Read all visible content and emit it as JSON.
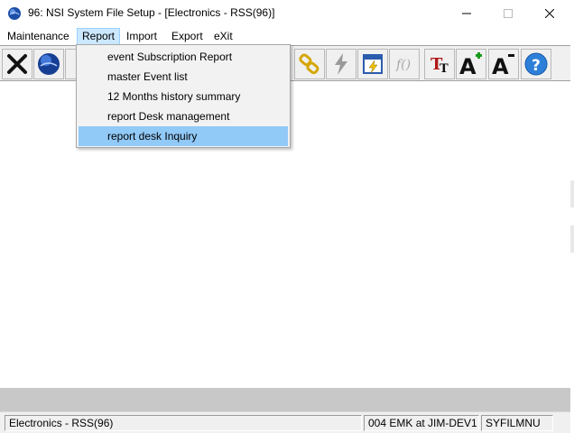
{
  "window": {
    "title": "96: NSI System File Setup - [Electronics - RSS(96)]",
    "controls": {
      "minimize": "–",
      "maximize": "☐",
      "close": "✕"
    }
  },
  "menubar": {
    "items": [
      "Maintenance",
      "Report",
      "Import",
      "Export",
      "eXit"
    ],
    "active": "Report"
  },
  "report_menu": {
    "items": [
      "event Subscription Report",
      "master Event list",
      "12 Months history summary",
      "report Desk management",
      "report desk Inquiry"
    ],
    "highlighted": "report desk Inquiry"
  },
  "toolbar": {
    "buttons": [
      {
        "icon": "exit-x-icon"
      },
      {
        "icon": "globe-icon"
      },
      {
        "icon": "chain-link-icon"
      },
      {
        "icon": "lightning-icon"
      },
      {
        "icon": "calendar-lightning-icon"
      },
      {
        "icon": "function-icon"
      },
      {
        "icon": "font-size-icon"
      },
      {
        "icon": "font-increase-icon"
      },
      {
        "icon": "font-decrease-icon"
      },
      {
        "icon": "help-icon"
      }
    ]
  },
  "statusbar": {
    "left": "Electronics - RSS(96)",
    "middle": "004 EMK at JIM-DEV1",
    "right": "SYFILMNU"
  },
  "colors": {
    "menu_active_bg": "#cce8ff",
    "menu_highlight_bg": "#91c9f7",
    "toolbar_bg": "#f0f0f0",
    "bottom_band": "#c8c8c8"
  }
}
